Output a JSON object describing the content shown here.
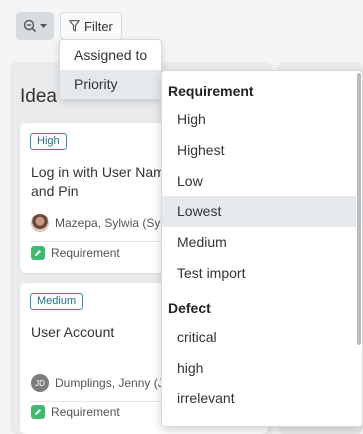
{
  "toolbar": {
    "zoom_icon": "zoom-out-icon",
    "filter_label": "Filter"
  },
  "column": {
    "title": "Idea"
  },
  "cards": [
    {
      "priority": "High",
      "title_line1": "Log in with User Nam",
      "title_line2": "and Pin",
      "assignee": "Mazepa, Sylwia (Sylv",
      "type": "Requirement"
    },
    {
      "priority": "Medium",
      "title_line1": "User Account",
      "avatar_initials": "JD",
      "assignee": "Dumplings, Jenny (J.",
      "type": "Requirement"
    }
  ],
  "filter_menu": {
    "items": [
      {
        "label": "Assigned to"
      },
      {
        "label": "Priority"
      }
    ],
    "active": "Priority"
  },
  "priority_menu": {
    "groups": [
      {
        "heading": "Requirement",
        "options": [
          "High",
          "Highest",
          "Low",
          "Lowest",
          "Medium",
          "Test import"
        ]
      },
      {
        "heading": "Defect",
        "options": [
          "critical",
          "high",
          "irrelevant"
        ]
      }
    ],
    "highlighted": "Lowest"
  },
  "colors": {
    "badge_border": "#2a8fa8",
    "requirement_icon": "#3fb96f",
    "menu_highlight": "#e6eaed"
  }
}
